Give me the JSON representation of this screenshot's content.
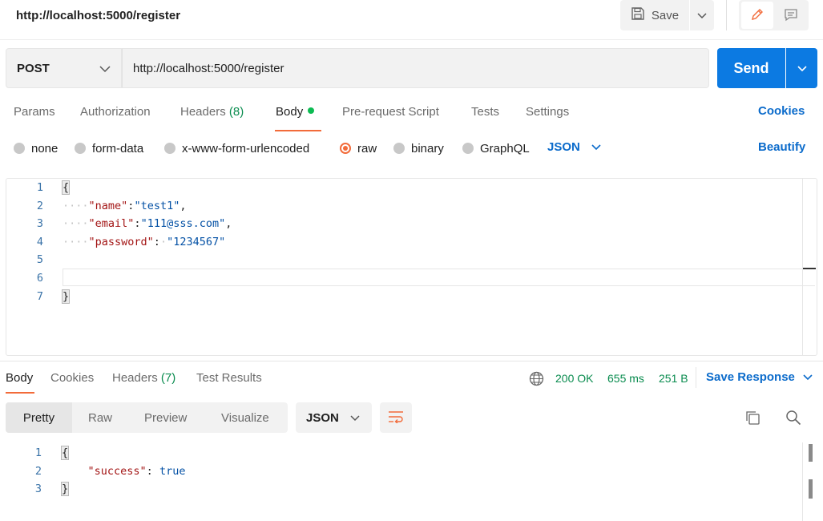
{
  "topbar": {
    "request_title": "http://localhost:5000/register",
    "save_label": "Save"
  },
  "request": {
    "method": "POST",
    "url": "http://localhost:5000/register",
    "send_label": "Send"
  },
  "request_tabs": {
    "params": "Params",
    "authorization": "Authorization",
    "headers": "Headers",
    "headers_count": "(8)",
    "body": "Body",
    "pre_request": "Pre-request Script",
    "tests": "Tests",
    "settings": "Settings",
    "cookies": "Cookies"
  },
  "body_types": {
    "none": "none",
    "form_data": "form-data",
    "urlencoded": "x-www-form-urlencoded",
    "raw": "raw",
    "binary": "binary",
    "graphql": "GraphQL",
    "selected": "raw",
    "language": "JSON",
    "beautify": "Beautify"
  },
  "request_body": {
    "line_numbers": [
      "1",
      "2",
      "3",
      "4",
      "5",
      "6",
      "7"
    ],
    "open_brace": "{",
    "close_brace": "}",
    "fields": [
      {
        "key": "\"name\"",
        "sep": ":",
        "value": "\"test1\"",
        "trail": ","
      },
      {
        "key": "\"email\"",
        "sep": ":",
        "value": "\"111@sss.com\"",
        "trail": ","
      },
      {
        "key": "\"password\"",
        "sep": ":",
        "value": "\"1234567\"",
        "trail": ""
      }
    ]
  },
  "response_tabs": {
    "body": "Body",
    "cookies": "Cookies",
    "headers": "Headers",
    "headers_count": "(7)",
    "test_results": "Test Results"
  },
  "response_status": {
    "status": "200 OK",
    "time": "655 ms",
    "size": "251 B",
    "save_response": "Save Response"
  },
  "response_view": {
    "pretty": "Pretty",
    "raw": "Raw",
    "preview": "Preview",
    "visualize": "Visualize",
    "language": "JSON"
  },
  "response_body": {
    "line_numbers": [
      "1",
      "2",
      "3"
    ],
    "open_brace": "{",
    "close_brace": "}",
    "key": "\"success\"",
    "sep": ": ",
    "value": "true"
  },
  "colors": {
    "accent": "#f26b3a",
    "primary": "#0c7ae2",
    "link": "#0b6bcb",
    "success": "#0a8c4f"
  }
}
